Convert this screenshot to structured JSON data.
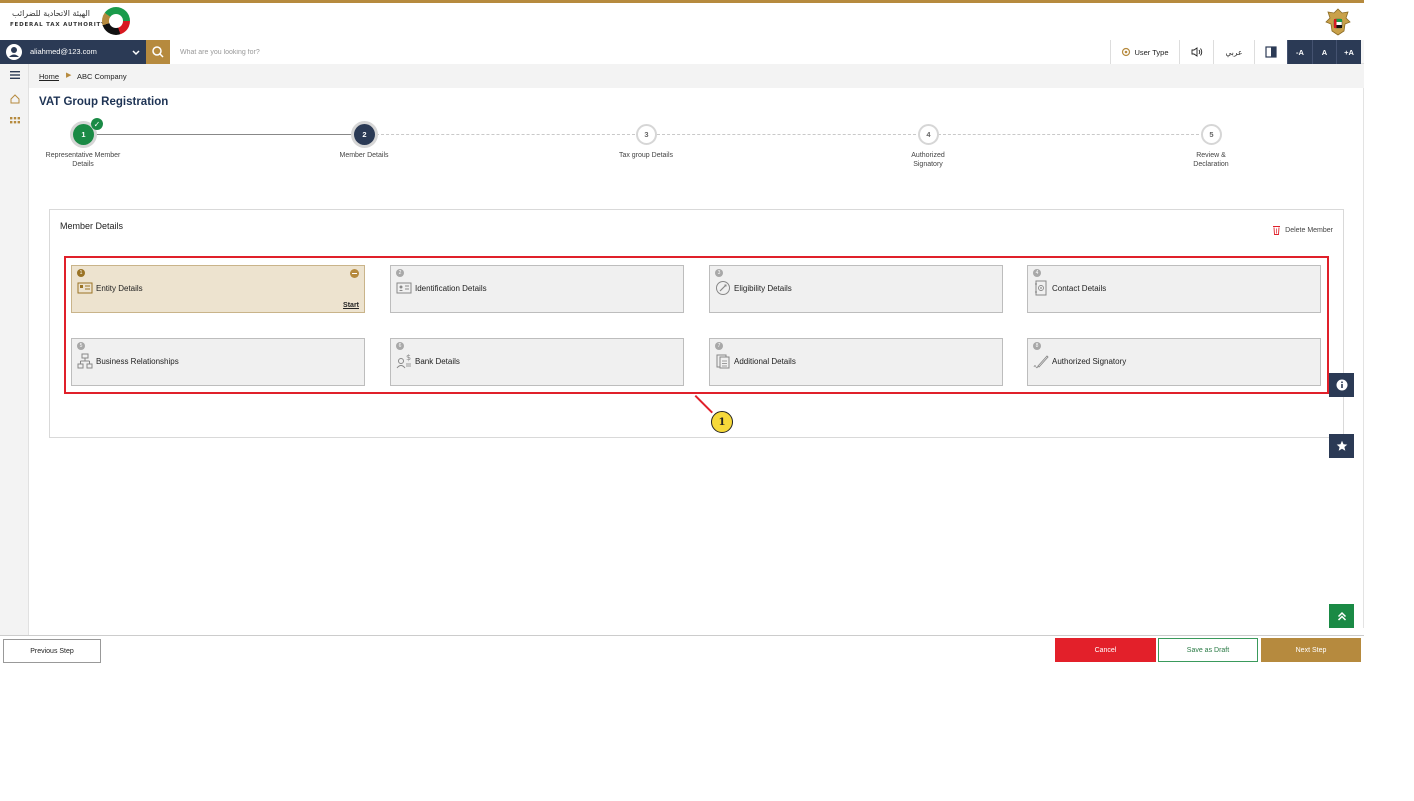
{
  "header": {
    "logo_arabic": "الهيئة الاتحادية للضرائب",
    "logo_english": "FEDERAL TAX AUTHORITY"
  },
  "nav": {
    "user_email": "aliahmed@123.com",
    "search_placeholder": "What are you looking for?",
    "user_type": "User Type",
    "language": "عربي",
    "font_decrease": "-A",
    "font_normal": "A",
    "font_increase": "+A"
  },
  "breadcrumb": {
    "home": "Home",
    "current": "ABC Company"
  },
  "page": {
    "title": "VAT Group Registration"
  },
  "stepper": [
    {
      "number": "1",
      "label": "Representative Member Details",
      "state": "completed"
    },
    {
      "number": "2",
      "label": "Member Details",
      "state": "active"
    },
    {
      "number": "3",
      "label": "Tax group Details",
      "state": "pending"
    },
    {
      "number": "4",
      "label": "Authorized Signatory",
      "state": "pending"
    },
    {
      "number": "5",
      "label": "Review & Declaration",
      "state": "pending"
    }
  ],
  "member_panel": {
    "title": "Member Details",
    "delete_label": "Delete Member",
    "cards": [
      {
        "number": "1",
        "label": "Entity Details",
        "icon": "entity-card-icon",
        "active": true,
        "action": "Start"
      },
      {
        "number": "2",
        "label": "Identification Details",
        "icon": "id-card-icon"
      },
      {
        "number": "3",
        "label": "Eligibility Details",
        "icon": "eligibility-icon"
      },
      {
        "number": "4",
        "label": "Contact Details",
        "icon": "contact-book-icon"
      },
      {
        "number": "5",
        "label": "Business Relationships",
        "icon": "org-chart-icon"
      },
      {
        "number": "6",
        "label": "Bank Details",
        "icon": "bank-user-icon"
      },
      {
        "number": "7",
        "label": "Additional Details",
        "icon": "document-icon"
      },
      {
        "number": "8",
        "label": "Authorized Signatory",
        "icon": "signature-pen-icon"
      }
    ]
  },
  "annotation": {
    "callout_number": "1"
  },
  "footer": {
    "previous": "Previous Step",
    "cancel": "Cancel",
    "save_draft": "Save as Draft",
    "next": "Next Step"
  },
  "colors": {
    "brand_gold": "#b68a3e",
    "navy": "#2b3a55",
    "success_green": "#1a8a45",
    "danger_red": "#e3202a",
    "highlight_red": "#e0202a"
  }
}
